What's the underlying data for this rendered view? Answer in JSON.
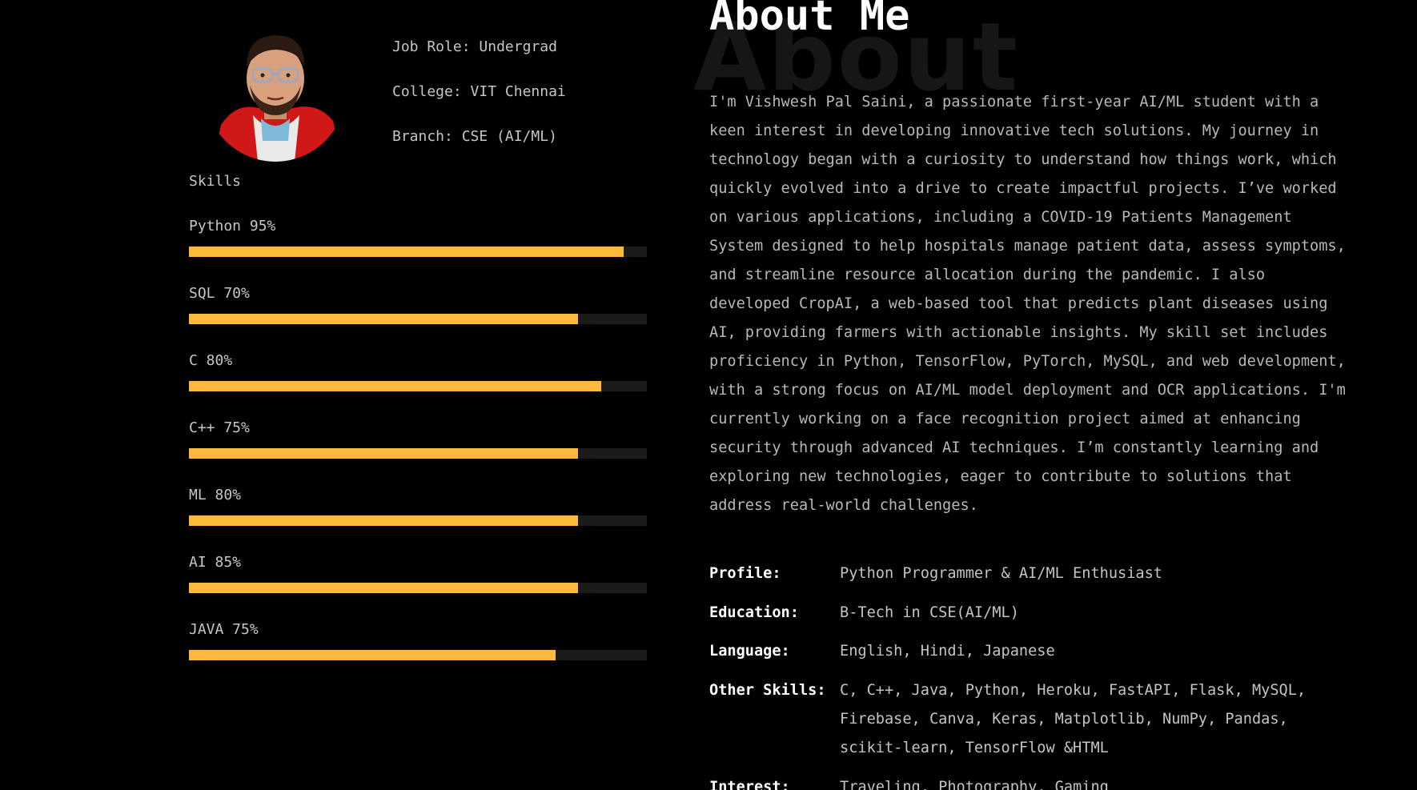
{
  "profile_card": {
    "avatar_alt": "profile photo",
    "job_role_label": "Job Role:",
    "job_role_value": "Undergrad",
    "college_label": "College:",
    "college_value": "VIT Chennai",
    "branch_label": "Branch:",
    "branch_value": "CSE (AI/ML)"
  },
  "skills": {
    "heading": "Skills",
    "items": [
      {
        "label": "Python 95%",
        "level": 0.95
      },
      {
        "label": "SQL 70%",
        "level": 0.85
      },
      {
        "label": "C 80%",
        "level": 0.9
      },
      {
        "label": "C++ 75%",
        "level": 0.85
      },
      {
        "label": "ML 80%",
        "level": 0.85
      },
      {
        "label": "AI 85%",
        "level": 0.85
      },
      {
        "label": "JAVA 75%",
        "level": 0.8
      }
    ]
  },
  "about": {
    "background_word": "About",
    "title": "About Me",
    "bio": "I'm Vishwesh Pal Saini, a passionate first-year AI/ML student with a keen interest in developing innovative tech solutions. My journey in technology began with a curiosity to understand how things work, which quickly evolved into a drive to create impactful projects. I’ve worked on various applications, including a COVID-19 Patients Management System designed to help hospitals manage patient data, assess symptoms, and streamline resource allocation during the pandemic. I also developed CropAI, a web-based tool that predicts plant diseases using AI, providing farmers with actionable insights. My skill set includes proficiency in Python, TensorFlow, PyTorch, MySQL, and web development, with a strong focus on AI/ML model deployment and OCR applications. I'm currently working on a face recognition project aimed at enhancing security through advanced AI techniques. I’m constantly learning and exploring new technologies, eager to contribute to solutions that address real-world challenges.",
    "details": [
      {
        "label": "Profile:",
        "value": "Python Programmer & AI/ML Enthusiast"
      },
      {
        "label": "Education:",
        "value": "B-Tech in CSE(AI/ML)"
      },
      {
        "label": "Language:",
        "value": "English, Hindi, Japanese"
      },
      {
        "label": "Other Skills:",
        "value": "C, C++, Java, Python, Heroku, FastAPI, Flask, MySQL, Firebase, Canva, Keras, Matplotlib, NumPy, Pandas, scikit-learn, TensorFlow &HTML"
      },
      {
        "label": "Interest:",
        "value": "Traveling, Photography, Gaming"
      }
    ]
  },
  "colors": {
    "background": "#000000",
    "accent_bar": "#fbba3d",
    "bar_track": "#1b1b1b",
    "title": "#ffffff",
    "body_text": "#b8b8b8"
  }
}
